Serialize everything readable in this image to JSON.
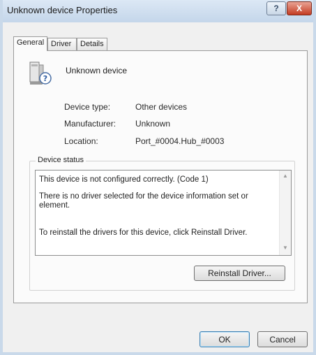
{
  "window": {
    "title": "Unknown device Properties",
    "help_glyph": "?",
    "close_glyph": "X"
  },
  "tabs": [
    {
      "label": "General",
      "active": true
    },
    {
      "label": "Driver",
      "active": false
    },
    {
      "label": "Details",
      "active": false
    }
  ],
  "device": {
    "name": "Unknown device",
    "icon": "unknown-device-icon",
    "properties": [
      {
        "label": "Device type:",
        "value": "Other devices"
      },
      {
        "label": "Manufacturer:",
        "value": "Unknown"
      },
      {
        "label": "Location:",
        "value": "Port_#0004.Hub_#0003"
      }
    ]
  },
  "status": {
    "group_label": "Device status",
    "lines": [
      "This device is not configured correctly. (Code 1)",
      "There is no driver selected for the device information set or",
      "element.",
      "To reinstall the drivers for this device, click Reinstall Driver."
    ],
    "reinstall_label": "Reinstall Driver..."
  },
  "buttons": {
    "ok": "OK",
    "cancel": "Cancel"
  },
  "colors": {
    "titlebar": "#c4d6ea",
    "close_button": "#c43c22",
    "default_button_border": "#3c7fb1"
  }
}
